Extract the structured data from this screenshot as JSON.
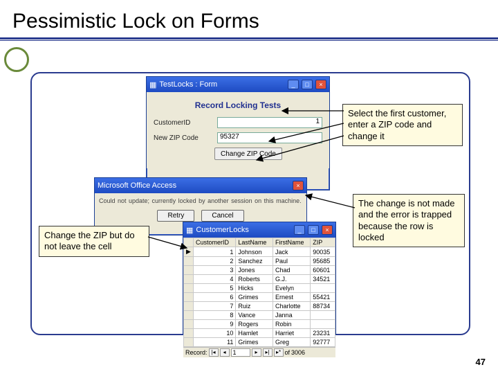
{
  "slide": {
    "title": "Pessimistic Lock on Forms",
    "pageNumber": "47"
  },
  "callouts": {
    "topRight": "Select the first customer, enter a ZIP code and change it",
    "left": "Change the ZIP but do not leave the cell",
    "right": "The change is not made and the error is trapped because the row is locked"
  },
  "form1": {
    "title": "TestLocks : Form",
    "heading": "Record Locking Tests",
    "rows": {
      "customerId": {
        "label": "CustomerID",
        "value": "1"
      },
      "newZip": {
        "label": "New ZIP Code",
        "value": "95327"
      }
    },
    "button": "Change ZIP Code"
  },
  "dialog": {
    "title": "Microsoft Office Access",
    "message": "Could not update; currently locked by another session on this machine.",
    "buttons": {
      "retry": "Retry",
      "cancel": "Cancel"
    }
  },
  "datasheet": {
    "title": "CustomerLocks",
    "columns": [
      "CustomerID",
      "LastName",
      "FirstName",
      "ZIP"
    ],
    "rows": [
      {
        "id": "1",
        "last": "Johnson",
        "first": "Jack",
        "zip": "90035"
      },
      {
        "id": "2",
        "last": "Sanchez",
        "first": "Paul",
        "zip": "95685"
      },
      {
        "id": "3",
        "last": "Jones",
        "first": "Chad",
        "zip": "60601"
      },
      {
        "id": "4",
        "last": "Roberts",
        "first": "G.J.",
        "zip": "34521"
      },
      {
        "id": "5",
        "last": "Hicks",
        "first": "Evelyn",
        "zip": ""
      },
      {
        "id": "6",
        "last": "Grimes",
        "first": "Ernest",
        "zip": "55421"
      },
      {
        "id": "7",
        "last": "Ruiz",
        "first": "Charlotte",
        "zip": "88734"
      },
      {
        "id": "8",
        "last": "Vance",
        "first": "Janna",
        "zip": ""
      },
      {
        "id": "9",
        "last": "Rogers",
        "first": "Robin",
        "zip": ""
      },
      {
        "id": "10",
        "last": "Hamlet",
        "first": "Harriet",
        "zip": "23231"
      },
      {
        "id": "11",
        "last": "Grimes",
        "first": "Greg",
        "zip": "92777"
      }
    ],
    "nav": {
      "label": "Record:",
      "position": "1",
      "ofLabel": "of",
      "total": "3006"
    }
  }
}
